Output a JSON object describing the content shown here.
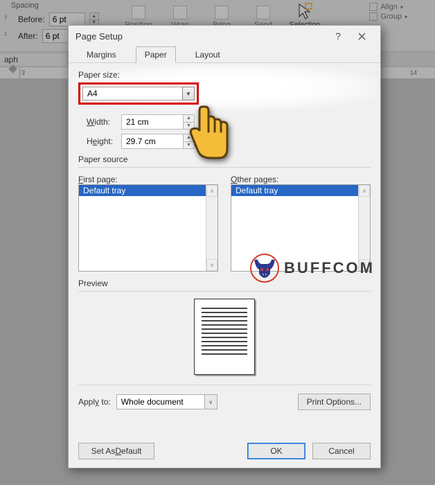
{
  "ribbon": {
    "spacing_title": "Spacing",
    "before_label": "Before:",
    "before_value": "6 pt",
    "after_label": "After:",
    "after_value": "6 pt",
    "graph_label": "aph",
    "btn_position": "Position",
    "btn_wrap": "Wrap",
    "btn_bring": "Bring",
    "btn_send": "Send",
    "btn_selection": "Selection",
    "btn_align": "Align",
    "btn_group": "Group"
  },
  "ruler": {
    "marks": [
      "3",
      "14"
    ]
  },
  "dialog": {
    "title": "Page Setup",
    "help_symbol": "?",
    "tabs": {
      "margins": "Margins",
      "paper": "Paper",
      "layout": "Layout"
    },
    "paper_size_label": "Paper size:",
    "paper_size_value": "A4",
    "width_label": "Width:",
    "width_value": "21 cm",
    "height_label": "Height:",
    "height_value": "29.7 cm",
    "paper_source_label": "Paper source",
    "first_page_label": "First page:",
    "other_pages_label": "Other pages:",
    "tray_option": "Default tray",
    "preview_label": "Preview",
    "apply_to_label": "Apply to:",
    "apply_to_value": "Whole document",
    "print_options": "Print Options...",
    "set_default": "Set As Default",
    "ok": "OK",
    "cancel": "Cancel"
  },
  "watermark": {
    "text": "BUFFCOM"
  }
}
